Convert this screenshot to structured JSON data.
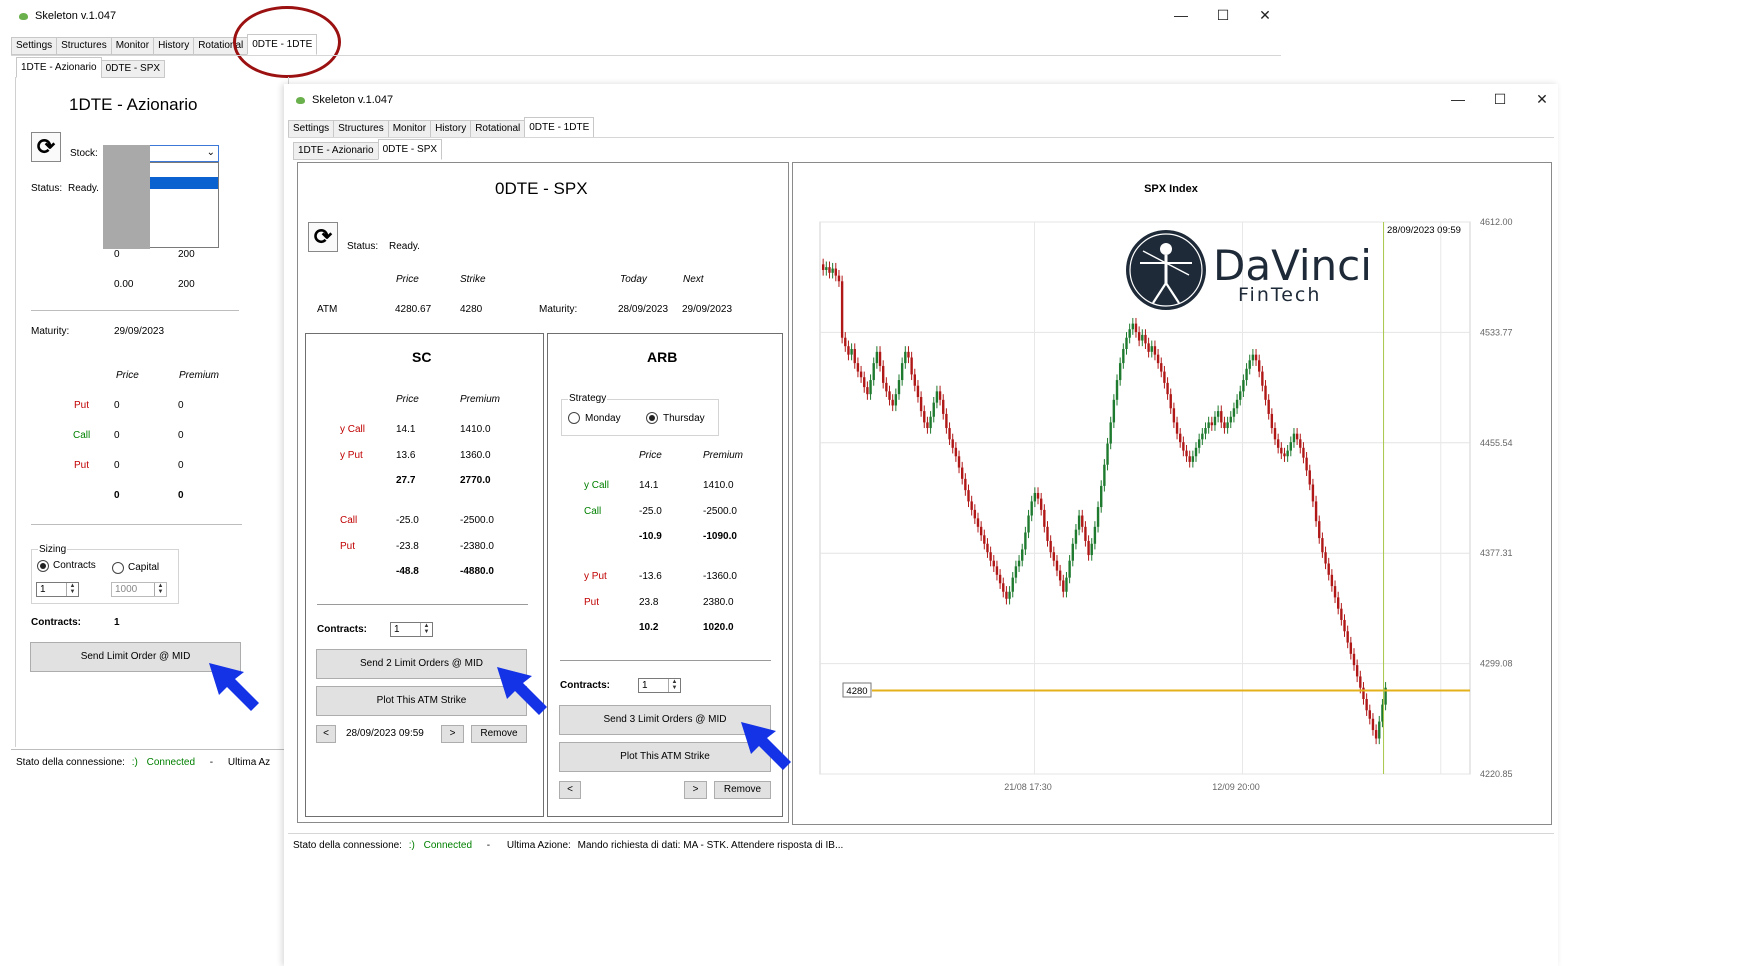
{
  "back_window": {
    "title": "Skeleton v.1.047",
    "tabs": [
      "Settings",
      "Structures",
      "Monitor",
      "History",
      "Rotational",
      "0DTE - 1DTE"
    ],
    "subtabs": [
      "1DTE - Azionario",
      "0DTE - SPX"
    ],
    "heading": "1DTE - Azionario",
    "stock_label": "Stock:",
    "status_label": "Status:",
    "status_value": "Ready.",
    "row_a": [
      "0",
      "200"
    ],
    "row_b": [
      "0.00",
      "200"
    ],
    "maturity_label": "Maturity:",
    "maturity_value": "29/09/2023",
    "col_price": "Price",
    "col_premium": "Premium",
    "legs": [
      {
        "label": "Put",
        "price": "0",
        "premium": "0"
      },
      {
        "label": "Call",
        "price": "0",
        "premium": "0"
      },
      {
        "label": "Put",
        "price": "0",
        "premium": "0"
      }
    ],
    "total_price": "0",
    "total_premium": "0",
    "sizing_label": "Sizing",
    "radio_contracts": "Contracts",
    "radio_capital": "Capital",
    "contracts_spin": "1",
    "capital_spin": "1000",
    "contracts_label": "Contracts:",
    "contracts_value": "1",
    "send_button": "Send Limit Order @ MID",
    "status_bar_label": "Stato della connessione:",
    "status_bar_smiley": ":)",
    "status_bar_connected": "Connected",
    "status_bar_dash": "-",
    "status_bar_last": "Ultima Az"
  },
  "front_window": {
    "title": "Skeleton v.1.047",
    "tabs": [
      "Settings",
      "Structures",
      "Monitor",
      "History",
      "Rotational",
      "0DTE - 1DTE"
    ],
    "subtabs": [
      "1DTE - Azionario",
      "0DTE - SPX"
    ],
    "heading": "0DTE - SPX",
    "status_label": "Status:",
    "status_value": "Ready.",
    "hdr_price": "Price",
    "hdr_strike": "Strike",
    "hdr_today": "Today",
    "hdr_next": "Next",
    "atm_label": "ATM",
    "atm_price": "4280.67",
    "atm_strike": "4280",
    "maturity_label": "Maturity:",
    "maturity_today": "28/09/2023",
    "maturity_next": "29/09/2023",
    "sc": {
      "title": "SC",
      "col_price": "Price",
      "col_premium": "Premium",
      "rows": [
        {
          "label": "y Call",
          "price": "14.1",
          "premium": "1410.0"
        },
        {
          "label": "y Put",
          "price": "13.6",
          "premium": "1360.0"
        }
      ],
      "sum1_price": "27.7",
      "sum1_premium": "2770.0",
      "rows2": [
        {
          "label": "Call",
          "price": "-25.0",
          "premium": "-2500.0"
        },
        {
          "label": "Put",
          "price": "-23.8",
          "premium": "-2380.0"
        }
      ],
      "sum2_price": "-48.8",
      "sum2_premium": "-4880.0",
      "contracts_label": "Contracts:",
      "contracts_spin": "1",
      "send_button": "Send 2 Limit Orders @ MID",
      "plot_button": "Plot This ATM Strike",
      "prev": "<",
      "date": "28/09/2023 09:59",
      "next": ">",
      "remove": "Remove"
    },
    "arb": {
      "title": "ARB",
      "strategy_label": "Strategy",
      "monday": "Monday",
      "thursday": "Thursday",
      "col_price": "Price",
      "col_premium": "Premium",
      "rows": [
        {
          "label": "y Call",
          "price": "14.1",
          "premium": "1410.0"
        },
        {
          "label": "Call",
          "price": "-25.0",
          "premium": "-2500.0"
        }
      ],
      "sum1_price": "-10.9",
      "sum1_premium": "-1090.0",
      "rows2": [
        {
          "label": "y Put",
          "price": "-13.6",
          "premium": "-1360.0"
        },
        {
          "label": "Put",
          "price": "23.8",
          "premium": "2380.0"
        }
      ],
      "sum2_price": "10.2",
      "sum2_premium": "1020.0",
      "contracts_label": "Contracts:",
      "contracts_spin": "1",
      "send_button": "Send 3 Limit Orders @ MID",
      "plot_button": "Plot This ATM Strike",
      "prev": "<",
      "next": ">",
      "remove": "Remove"
    },
    "status_bar_label": "Stato della connessione:",
    "status_bar_smiley": ":)",
    "status_bar_connected": "Connected",
    "status_bar_dash": "-",
    "status_bar_last_label": "Ultima Azione:",
    "status_bar_last": "Mando richiesta di dati: MA - STK. Attendere risposta di IB..."
  },
  "logo": {
    "line1": "DaVinci",
    "line2": "FinTech"
  },
  "colors": {
    "up": "#1e7a2e",
    "down": "#b01818",
    "strike_line": "#e3b21a",
    "annotation": "#9b1010",
    "arrow": "#1432e6"
  },
  "chart_data": {
    "type": "candlestick",
    "title": "SPX Index",
    "date_stamp": "28/09/2023 09:59",
    "y_ticks": [
      "4612.00",
      "4533.77",
      "4455.54",
      "4377.31",
      "4299.08",
      "4220.85"
    ],
    "ylim": [
      4220.85,
      4612.0
    ],
    "x_ticks": [
      "21/08 17:30",
      "12/09 20:00"
    ],
    "strike_label": "4280",
    "strike_value": 4280,
    "series": [
      4582,
      4578,
      4580,
      4576,
      4579,
      4574,
      4570,
      4530,
      4524,
      4518,
      4522,
      4512,
      4506,
      4502,
      4495,
      4490,
      4500,
      4512,
      4520,
      4510,
      4498,
      4492,
      4486,
      4482,
      4490,
      4500,
      4512,
      4520,
      4516,
      4504,
      4496,
      4488,
      4478,
      4470,
      4466,
      4474,
      4484,
      4492,
      4486,
      4476,
      4466,
      4458,
      4452,
      4446,
      4438,
      4430,
      4422,
      4414,
      4408,
      4402,
      4396,
      4390,
      4384,
      4378,
      4372,
      4368,
      4362,
      4356,
      4350,
      4345,
      4350,
      4360,
      4368,
      4372,
      4380,
      4392,
      4404,
      4414,
      4420,
      4416,
      4408,
      4396,
      4386,
      4378,
      4372,
      4365,
      4358,
      4350,
      4360,
      4372,
      4384,
      4394,
      4404,
      4396,
      4386,
      4376,
      4384,
      4396,
      4410,
      4425,
      4440,
      4455,
      4470,
      4486,
      4500,
      4512,
      4522,
      4530,
      4536,
      4540,
      4534,
      4528,
      4532,
      4526,
      4520,
      4524,
      4518,
      4512,
      4506,
      4498,
      4490,
      4480,
      4470,
      4462,
      4456,
      4450,
      4446,
      4442,
      4446,
      4452,
      4458,
      4462,
      4466,
      4470,
      4468,
      4474,
      4478,
      4470,
      4466,
      4470,
      4474,
      4480,
      4486,
      4492,
      4500,
      4508,
      4514,
      4518,
      4514,
      4506,
      4496,
      4486,
      4476,
      4466,
      4458,
      4452,
      4448,
      4446,
      4450,
      4456,
      4462,
      4458,
      4452,
      4445,
      4436,
      4426,
      4414,
      4400,
      4388,
      4378,
      4370,
      4362,
      4354,
      4346,
      4338,
      4330,
      4322,
      4314,
      4306,
      4298,
      4290,
      4282,
      4274,
      4266,
      4260,
      4252,
      4246,
      4258,
      4270,
      4282
    ]
  }
}
